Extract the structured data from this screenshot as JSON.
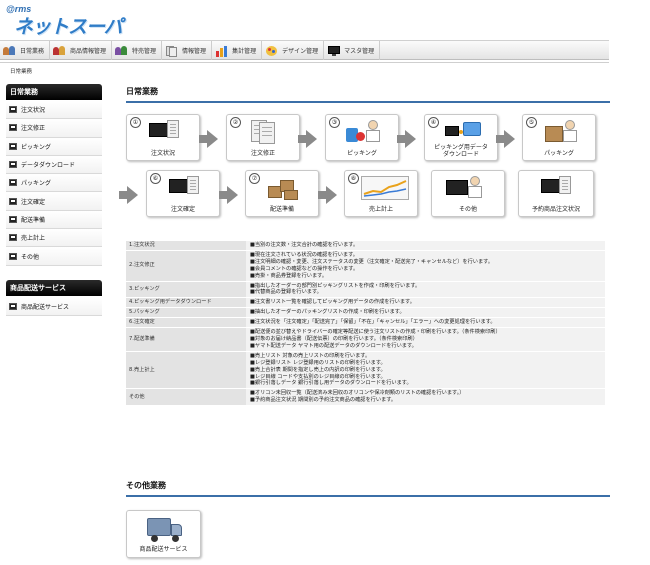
{
  "logo": {
    "prefix": "@rms",
    "name": "ネットスーパー"
  },
  "nav": [
    {
      "label": "日常業務",
      "icon": "people-icon"
    },
    {
      "label": "商品情報管理",
      "icon": "people-icon"
    },
    {
      "label": "特売管理",
      "icon": "people-icon"
    },
    {
      "label": "情報管理",
      "icon": "papers-icon"
    },
    {
      "label": "集計管理",
      "icon": "bar-chart-icon"
    },
    {
      "label": "デザイン管理",
      "icon": "palette-icon"
    },
    {
      "label": "マスタ管理",
      "icon": "monitor-icon"
    }
  ],
  "breadcrumb": "日常業務",
  "sidebar": {
    "daily_header": "日常業務",
    "daily_items": [
      "注文状況",
      "注文修正",
      "ピッキング",
      "データダウンロード",
      "パッキング",
      "注文確定",
      "配送準備",
      "売上計上",
      "その他"
    ],
    "delivery_header": "商品配送サービス",
    "delivery_items": [
      "商品配送サービス"
    ]
  },
  "main": {
    "title": "日常業務",
    "flow": [
      {
        "num": "①",
        "label": "注文状況"
      },
      {
        "num": "②",
        "label": "注文修正"
      },
      {
        "num": "③",
        "label": "ピッキング"
      },
      {
        "num": "④",
        "label": "ピッキング用データ\nダウンロード"
      },
      {
        "num": "⑤",
        "label": "パッキング"
      },
      {
        "num": "⑥",
        "label": "注文確定"
      },
      {
        "num": "⑦",
        "label": "配送準備"
      },
      {
        "num": "⑧",
        "label": "売上計上"
      },
      {
        "num": "",
        "label": "その他"
      },
      {
        "num": "",
        "label": "予約商品注文状況"
      }
    ],
    "table": [
      {
        "key": "1.注文状況",
        "lines": [
          "■当別の注文数・注文合計の確認を行います。"
        ]
      },
      {
        "key": "2.注文修正",
        "lines": [
          "■現在注文されている状況の確認を行います。",
          "■注文明細の確認・変更、注文ステータスの変更（注文確定・配送完了・キャンセルなど）を行います。",
          "■会員コメントの確認などの操作を行います。",
          "■売掛・商品券登録を行います。"
        ]
      },
      {
        "key": "3.ピッキング",
        "lines": [
          "■指出したオーダーの部門別ピッキングリストを作成・印刷を行います。",
          "■代替商品の登録を行います。"
        ]
      },
      {
        "key": "4.ピッキング用データダウンロード",
        "lines": [
          "■注文書リスト一覧を確認してピッキング用データの作成を行います。"
        ]
      },
      {
        "key": "5.パッキング",
        "lines": [
          "■抽出したオーダーのパッキングリストの作成・印刷を行います。"
        ]
      },
      {
        "key": "6.注文確定",
        "lines": [
          "■注文状況を「注文確定」「配送完了」「保留」「不在」「キャンセル」「エラー」への変更処理を行います。"
        ]
      },
      {
        "key": "7.配送準備",
        "lines": [
          "■配送便の並び替えやドライバーの確定等配送に使う注文リストの作成・印刷を行います。（条件検索印刷）",
          "■対象のお届け納品書（配送伝票）の印刷を行います。（条件検索印刷）",
          "■ヤマト配送データ ヤマト用の配送データのダウンロードを行います。"
        ]
      },
      {
        "key": "8.売上計上",
        "lines": [
          "■売上リスト 対象の売上リストの印刷を行います。",
          "■レジ登録リスト レジ登録用のリストの印刷を行います。",
          "■売上合計表 期間を指定し売上の内訳の印刷を行います。",
          "■レジ目線 コードや支払別のレジ目線の印刷を行います。",
          "■銀行引落しデータ 銀行引落し用データのダウンロードを行います。"
        ]
      },
      {
        "key": "その他",
        "lines": [
          "■オリコン未回収一覧（配送済み未回収のオリコンや保冷剤類のリストの確認を行います。）",
          "■予約商品注文状況 期間別の予約注文商品の確認を行います。"
        ]
      }
    ],
    "other_title": "その他業務",
    "other_card": "商品配送サービス"
  }
}
